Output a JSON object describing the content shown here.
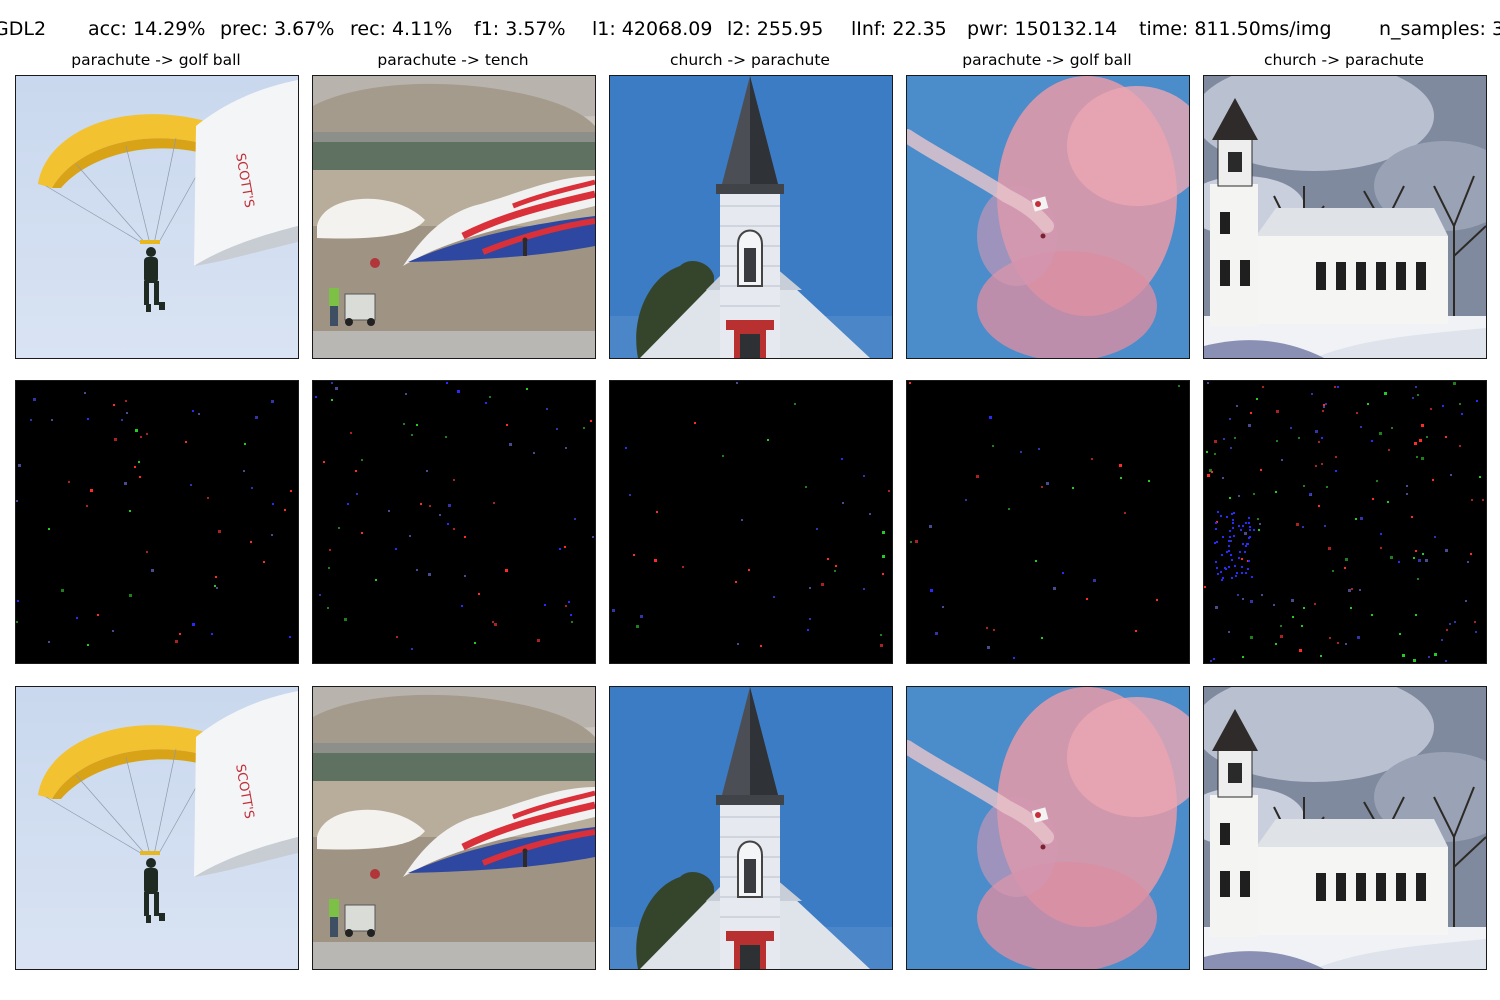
{
  "header": {
    "method": "GDL2",
    "acc": "acc: 14.29%",
    "prec": "prec: 3.67%",
    "rec": "rec: 4.11%",
    "f1": "f1: 3.57%",
    "l1": "l1: 42068.09",
    "l2": "l2: 255.95",
    "linf": "lInf: 22.35",
    "pwr": "pwr: 150132.14",
    "time": "time: 811.50ms/img",
    "n_samples": "n_samples: 3"
  },
  "columns": [
    {
      "title": "parachute -> golf ball",
      "scene": "yellow-parachute-skydiver"
    },
    {
      "title": "parachute -> tench",
      "scene": "landed-flag-parachute-field"
    },
    {
      "title": "church -> parachute",
      "scene": "church-steeple-blue-sky"
    },
    {
      "title": "parachute -> golf ball",
      "scene": "skydiver-pink-smoke"
    },
    {
      "title": "church -> parachute",
      "scene": "white-church-snow"
    }
  ],
  "flag_text": "SCOTT'S",
  "rows": [
    "original",
    "perturbation",
    "adversarial"
  ],
  "colors": {
    "sky_pale": "#cfdcef",
    "parachute_yellow": "#f2c230",
    "sky_blue": "#3d7bc4",
    "smoke_pink": "#e79aa8",
    "perturbation_bg": "#000000"
  }
}
